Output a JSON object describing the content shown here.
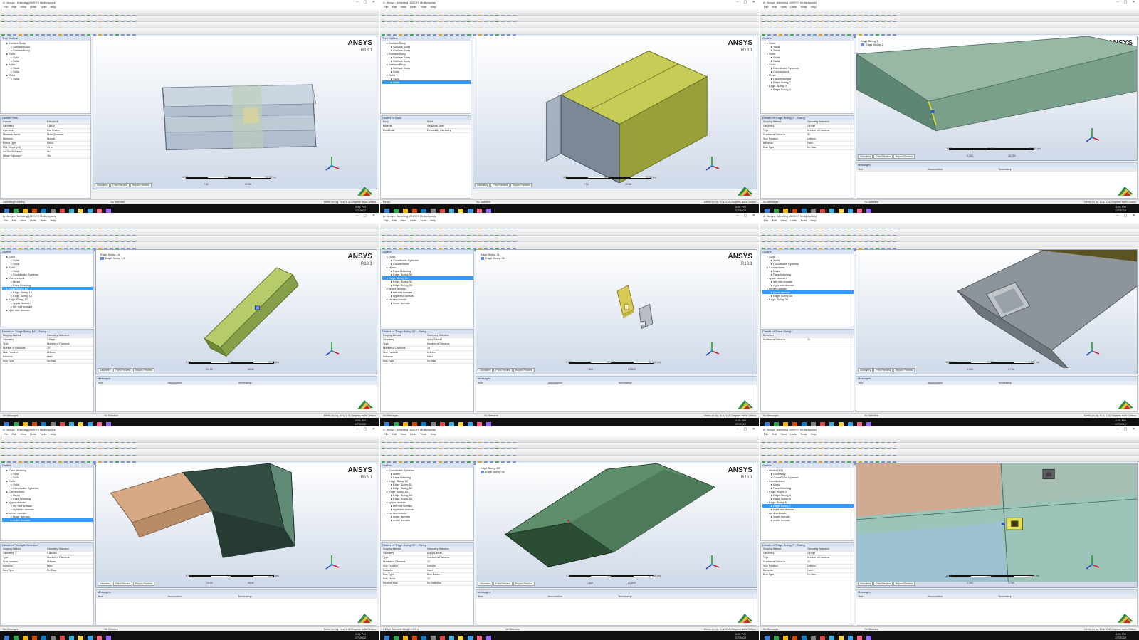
{
  "app": {
    "window_title": "A : Ansys - Meshing [ANSYS Multiphysics]",
    "menus": [
      "File",
      "Edit",
      "View",
      "Units",
      "Tools",
      "Help"
    ],
    "brand": "ANSYS",
    "version": "R18.1",
    "outline_title": "Outline",
    "tree_title": "Tree Outline",
    "detail_prefix": "Details of",
    "messages_title": "Messages",
    "message_columns": [
      "Text",
      "Association",
      "Timestamp"
    ],
    "tabs": [
      "Geometry",
      "Print Preview",
      "Report Preview"
    ],
    "status_left": "No Messages",
    "status_mid": "No Selection",
    "status_right": "Metric (m, kg, N, s, V, A)  Degrees  rad/s  Celsius",
    "clock_time": "4:05 PM",
    "clock_date": "2/7/2022"
  },
  "panels": [
    {
      "tree": [
        "Surface Body",
        "Surface Body",
        "Surface Body",
        "Solid",
        "Solid",
        "Solid",
        "Solid",
        "Solid",
        "Solid",
        "Solid",
        "Solid"
      ],
      "selected": -1,
      "detail_title": "Details View",
      "details": [
        [
          "Extrude",
          "Extrude18"
        ],
        [
          "Geometry",
          "1 Body"
        ],
        [
          "Operation",
          "Add Frozen"
        ],
        [
          "Direction Vector",
          "None (Normal)"
        ],
        [
          "Direction",
          "Normal"
        ],
        [
          "Extent Type",
          "Fixed"
        ],
        [
          "FD1, Depth (>0)",
          "15 m"
        ],
        [
          "As Thin/Surface?",
          "No"
        ],
        [
          "Merge Topology?",
          "Yes"
        ]
      ],
      "scale": [
        "0.00",
        "15.00",
        "30.00 (m)",
        "7.50",
        "22.50"
      ],
      "status": "Geometry Modeling"
    },
    {
      "tree": [
        "Surface Body",
        "Surface Body",
        "Surface Body",
        "Surface Body",
        "Surface Body",
        "Surface Body",
        "Surface Body",
        "Surface Body",
        "Solid",
        "Solid",
        "Solid",
        "Solid"
      ],
      "selected": 11,
      "detail_title": "Details of Solid",
      "details": [
        [
          "Body",
          "Solid"
        ],
        [
          "Material",
          "Structural Steel"
        ],
        [
          "Fluid/Solid",
          "Defined By Geometry"
        ]
      ],
      "scale": [
        "0.00",
        "15.00",
        "30.00 (m)",
        "7.50",
        "22.50"
      ],
      "status": "Ready"
    },
    {
      "tree": [
        "Solid",
        "Solid",
        "Solid",
        "Solid",
        "Solid",
        "Solid",
        "Solid",
        "Coordinate Systems",
        "Connections",
        "Mesh",
        "Face Meshing",
        "Edge Sizing 2",
        "Edge Sizing 3",
        "Edge Sizing 4"
      ],
      "selected": -1,
      "detail_title": "Details of \"Edge Sizing 2\" - Sizing",
      "details": [
        [
          "Scoping Method",
          "Geometry Selection"
        ],
        [
          "Geometry",
          "1 Edge"
        ],
        [
          "Type",
          "Number of Divisions"
        ],
        [
          "Number of Divisions",
          "50"
        ],
        [
          "Size Function",
          "Uniform"
        ],
        [
          "Behavior",
          "Hard"
        ],
        [
          "Bias Type",
          "No Bias"
        ]
      ],
      "scale": [
        "0.000",
        "12.500",
        "25.000 (m)",
        "6.250",
        "18.750"
      ],
      "info_title": "Edge Sizing 2",
      "info_line": "Edge Sizing 2",
      "status": "No Messages"
    },
    {
      "tree": [
        "Solid",
        "Solid",
        "Solid",
        "Solid",
        "Solid",
        "Coordinate Systems",
        "Connections",
        "Mesh",
        "Face Meshing",
        "Edge Sizing 14",
        "Edge Sizing 15",
        "Edge Sizing 16",
        "Edge Sizing 17",
        "upper domain",
        "left mid domain",
        "right mid domain"
      ],
      "selected": 9,
      "detail_title": "Details of \"Edge Sizing 14\" - Sizing",
      "details": [
        [
          "Scoping Method",
          "Geometry Selection"
        ],
        [
          "Geometry",
          "1 Edge"
        ],
        [
          "Type",
          "Number of Divisions"
        ],
        [
          "Number of Divisions",
          "10"
        ],
        [
          "Size Function",
          "Uniform"
        ],
        [
          "Behavior",
          "Hard"
        ],
        [
          "Bias Type",
          "No Bias"
        ]
      ],
      "scale": [
        "0.00",
        "40.00",
        "80.00 (m)",
        "20.00",
        "60.00"
      ],
      "info_title": "Edge Sizing 14",
      "info_line": "Edge Sizing 14",
      "status": "No Messages"
    },
    {
      "tree": [
        "Solid",
        "Coordinate Systems",
        "Connections",
        "Mesh",
        "Face Meshing",
        "Edge Sizing 30",
        "Edge Sizing 31",
        "Edge Sizing 32",
        "Edge Sizing 33",
        "upper domain",
        "left mid domain",
        "right mid domain",
        "center domain",
        "lower domain"
      ],
      "selected": 6,
      "detail_title": "Details of \"Edge Sizing 31\" - Sizing",
      "details": [
        [
          "Scoping Method",
          "Geometry Selection"
        ],
        [
          "Geometry",
          "Apply  Cancel"
        ],
        [
          "Type",
          "Number of Divisions"
        ],
        [
          "Number of Divisions",
          "10"
        ],
        [
          "Size Function",
          "Uniform"
        ],
        [
          "Behavior",
          "Hard"
        ],
        [
          "Bias Type",
          "No Bias"
        ]
      ],
      "scale": [
        "0.000",
        "15.000",
        "30.000 (m)",
        "7.500",
        "22.500"
      ],
      "info_title": "Edge Sizing 31",
      "info_line": "Edge Sizing 31",
      "status": "No Messages"
    },
    {
      "tree": [
        "Solid",
        "Solid",
        "Coordinate Systems",
        "Connections",
        "Mesh",
        "Face Meshing",
        "upper domain",
        "left mid domain",
        "right mid domain",
        "center domain",
        "lower domain",
        "Edge Sizing 34",
        "Edge Sizing 35"
      ],
      "selected": 10,
      "detail_title": "Details of \"Face Sizing\"",
      "details": [
        [
          "Definition",
          ""
        ],
        [
          "Number of Divisions",
          "10"
        ]
      ],
      "scale": [
        "0.000",
        "2.500",
        "5.000 (m)",
        "1.250",
        "3.750"
      ],
      "status": "No Messages"
    },
    {
      "tree": [
        "Face Meshing",
        "Solid",
        "Solid",
        "Solid",
        "Solid",
        "Coordinate Systems",
        "Connections",
        "Mesh",
        "Face Meshing",
        "upper domain",
        "left mid domain",
        "right mid domain",
        "center domain",
        "lower domain",
        "outlet domain"
      ],
      "selected": 14,
      "detail_title": "Details of \"Multiple Selection\"",
      "details": [
        [
          "Scoping Method",
          "Geometry Selection"
        ],
        [
          "Geometry",
          "5 Bodies"
        ],
        [
          "Type",
          "Number of Divisions"
        ],
        [
          "Size Function",
          "Uniform"
        ],
        [
          "Behavior",
          "Hard"
        ],
        [
          "Bias Type",
          "No Bias"
        ]
      ],
      "scale": [
        "0.00",
        "30.00",
        "60.00 (m)",
        "15.00",
        "45.00"
      ],
      "status": "No Messages"
    },
    {
      "tree": [
        "Coordinate Systems",
        "Mesh",
        "Face Meshing",
        "Edge Sizing 50",
        "Edge Sizing 51",
        "Edge Sizing 52",
        "Edge Sizing 53",
        "Edge Sizing 54",
        "Edge Sizing 55",
        "upper domain",
        "left mid domain",
        "right mid domain",
        "center domain",
        "lower domain",
        "outlet domain"
      ],
      "selected": -1,
      "detail_title": "Details of \"Edge Sizing 50\" - Sizing",
      "details": [
        [
          "Scoping Method",
          "Geometry Selection"
        ],
        [
          "Geometry",
          "Apply  Cancel"
        ],
        [
          "Type",
          "Number of Divisions"
        ],
        [
          "Number of Divisions",
          "10"
        ],
        [
          "Size Function",
          "Uniform"
        ],
        [
          "Behavior",
          "Hard"
        ],
        [
          "Bias Type",
          "Bias Factor"
        ],
        [
          "Bias Factor",
          "10"
        ],
        [
          "Reverse Bias",
          "No Selection"
        ]
      ],
      "scale": [
        "0.000",
        "15.000",
        "30.000 (m)",
        "7.500",
        "22.500"
      ],
      "info_title": "Edge Sizing 50",
      "info_line": "Edge Sizing 50",
      "status": "1 Edge Selected: Length = 0.5 m"
    },
    {
      "tree": [
        "Model (B3)",
        "Geometry",
        "Coordinate Systems",
        "Connections",
        "Mesh",
        "Face Meshing",
        "Edge Sizing 3",
        "Edge Sizing 4",
        "Edge Sizing 5",
        "Edge Sizing 6",
        "Edge Sizing 7",
        "right mid domain",
        "center domain",
        "lower domain",
        "outlet domain"
      ],
      "selected": 10,
      "detail_title": "Details of \"Edge Sizing 7\" - Sizing",
      "details": [
        [
          "Scoping Method",
          "Geometry Selection"
        ],
        [
          "Geometry",
          "1 Edge"
        ],
        [
          "Type",
          "Number of Divisions"
        ],
        [
          "Number of Divisions",
          "10"
        ],
        [
          "Size Function",
          "Uniform"
        ],
        [
          "Behavior",
          "Hard"
        ],
        [
          "Bias Type",
          "No Bias"
        ]
      ],
      "scale": [
        "0.000",
        "2.500",
        "5.000 (m)",
        "1.250",
        "3.750"
      ],
      "info_title": "Edge Sizing 7",
      "info_line": "Edge Sizing 7",
      "status": "No Messages"
    }
  ]
}
